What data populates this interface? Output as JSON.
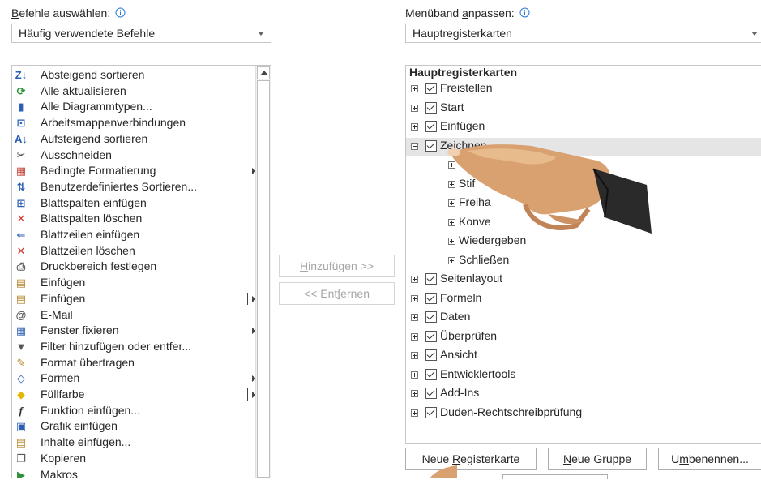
{
  "left_panel": {
    "label_mnemonic": "B",
    "label_rest": "efehle auswählen:",
    "info_icon": "info-icon",
    "combo_value": "Häufig verwendete Befehle",
    "commands": [
      {
        "label": "Absteigend sortieren",
        "icon": "sort-descending-icon",
        "submenu": "none"
      },
      {
        "label": "Alle aktualisieren",
        "icon": "refresh-all-icon",
        "submenu": "none"
      },
      {
        "label": "Alle Diagrammtypen...",
        "icon": "chart-types-icon",
        "submenu": "none"
      },
      {
        "label": "Arbeitsmappenverbindungen",
        "icon": "workbook-connections-icon",
        "submenu": "none"
      },
      {
        "label": "Aufsteigend sortieren",
        "icon": "sort-ascending-icon",
        "submenu": "none"
      },
      {
        "label": "Ausschneiden",
        "icon": "cut-icon",
        "submenu": "none"
      },
      {
        "label": "Bedingte Formatierung",
        "icon": "conditional-formatting-icon",
        "submenu": "arrow"
      },
      {
        "label": "Benutzerdefiniertes Sortieren...",
        "icon": "custom-sort-icon",
        "submenu": "none"
      },
      {
        "label": "Blattspalten einfügen",
        "icon": "insert-columns-icon",
        "submenu": "none"
      },
      {
        "label": "Blattspalten löschen",
        "icon": "delete-columns-icon",
        "submenu": "none"
      },
      {
        "label": "Blattzeilen einfügen",
        "icon": "insert-rows-icon",
        "submenu": "none"
      },
      {
        "label": "Blattzeilen löschen",
        "icon": "delete-rows-icon",
        "submenu": "none"
      },
      {
        "label": "Druckbereich festlegen",
        "icon": "print-area-icon",
        "submenu": "none"
      },
      {
        "label": "Einfügen",
        "icon": "paste-icon",
        "submenu": "none"
      },
      {
        "label": "Einfügen",
        "icon": "paste-options-icon",
        "submenu": "split"
      },
      {
        "label": "E-Mail",
        "icon": "email-icon",
        "submenu": "none"
      },
      {
        "label": "Fenster fixieren",
        "icon": "freeze-panes-icon",
        "submenu": "arrow"
      },
      {
        "label": "Filter hinzufügen oder entfer...",
        "icon": "filter-icon",
        "submenu": "none"
      },
      {
        "label": "Format übertragen",
        "icon": "format-painter-icon",
        "submenu": "none"
      },
      {
        "label": "Formen",
        "icon": "shapes-icon",
        "submenu": "arrow"
      },
      {
        "label": "Füllfarbe",
        "icon": "fill-color-icon",
        "submenu": "split"
      },
      {
        "label": "Funktion einfügen...",
        "icon": "insert-function-icon",
        "submenu": "none"
      },
      {
        "label": "Grafik einfügen",
        "icon": "insert-picture-icon",
        "submenu": "none"
      },
      {
        "label": "Inhalte einfügen...",
        "icon": "paste-special-icon",
        "submenu": "none"
      },
      {
        "label": "Kopieren",
        "icon": "copy-icon",
        "submenu": "none"
      },
      {
        "label": "Makros",
        "icon": "macros-icon",
        "submenu": "none"
      }
    ]
  },
  "middle": {
    "add_button_mnemonic": "H",
    "add_button_rest": "inzufügen >>",
    "remove_button_pre": "<< Ent",
    "remove_button_mnemonic": "f",
    "remove_button_rest": "ernen"
  },
  "right_panel": {
    "label_pre": "Menüband ",
    "label_mnemonic": "a",
    "label_rest": "npassen:",
    "combo_value": "Hauptregisterkarten",
    "tree_header": "Hauptregisterkarten",
    "tree": [
      {
        "label": "Freistellen",
        "level": 0,
        "expander": "plus",
        "checkbox": true
      },
      {
        "label": "Start",
        "level": 0,
        "expander": "plus",
        "checkbox": true
      },
      {
        "label": "Einfügen",
        "level": 0,
        "expander": "plus",
        "checkbox": true
      },
      {
        "label": "Zeichnen",
        "level": 0,
        "expander": "minus",
        "checkbox": true,
        "selected": true
      },
      {
        "label": "",
        "level": 1,
        "expander": "plus",
        "checkbox": false
      },
      {
        "label": "Stif",
        "level": 1,
        "expander": "plus",
        "checkbox": false
      },
      {
        "label": "Freiha",
        "level": 1,
        "expander": "plus",
        "checkbox": false
      },
      {
        "label": "Konve",
        "level": 1,
        "expander": "plus",
        "checkbox": false
      },
      {
        "label": "Wiedergeben",
        "level": 1,
        "expander": "plus",
        "checkbox": false
      },
      {
        "label": "Schließen",
        "level": 1,
        "expander": "plus",
        "checkbox": false
      },
      {
        "label": "Seitenlayout",
        "level": 0,
        "expander": "plus",
        "checkbox": true
      },
      {
        "label": "Formeln",
        "level": 0,
        "expander": "plus",
        "checkbox": true
      },
      {
        "label": "Daten",
        "level": 0,
        "expander": "plus",
        "checkbox": true
      },
      {
        "label": "Überprüfen",
        "level": 0,
        "expander": "plus",
        "checkbox": true
      },
      {
        "label": "Ansicht",
        "level": 0,
        "expander": "plus",
        "checkbox": true
      },
      {
        "label": "Entwicklertools",
        "level": 0,
        "expander": "plus",
        "checkbox": true
      },
      {
        "label": "Add-Ins",
        "level": 0,
        "expander": "plus",
        "checkbox": true
      },
      {
        "label": "Duden-Rechtschreibprüfung",
        "level": 0,
        "expander": "plus",
        "checkbox": true
      }
    ],
    "buttons": {
      "new_tab_pre": "Neue ",
      "new_tab_mnemonic": "R",
      "new_tab_rest": "egisterkarte",
      "new_group_mnemonic": "N",
      "new_group_rest": "eue Gruppe",
      "rename_pre": "U",
      "rename_mnemonic": "m",
      "rename_rest": "benennen..."
    }
  },
  "overlay": {
    "hand_pointer": "pointing-hand-icon"
  },
  "colors": {
    "selected_row": "#e5e5e5",
    "border": "#c6c6c6",
    "disabled_text": "#a6a6a6",
    "info_blue": "#2b78d0",
    "hand_skin": "#d9a070",
    "sleeve": "#2a2a2a"
  }
}
